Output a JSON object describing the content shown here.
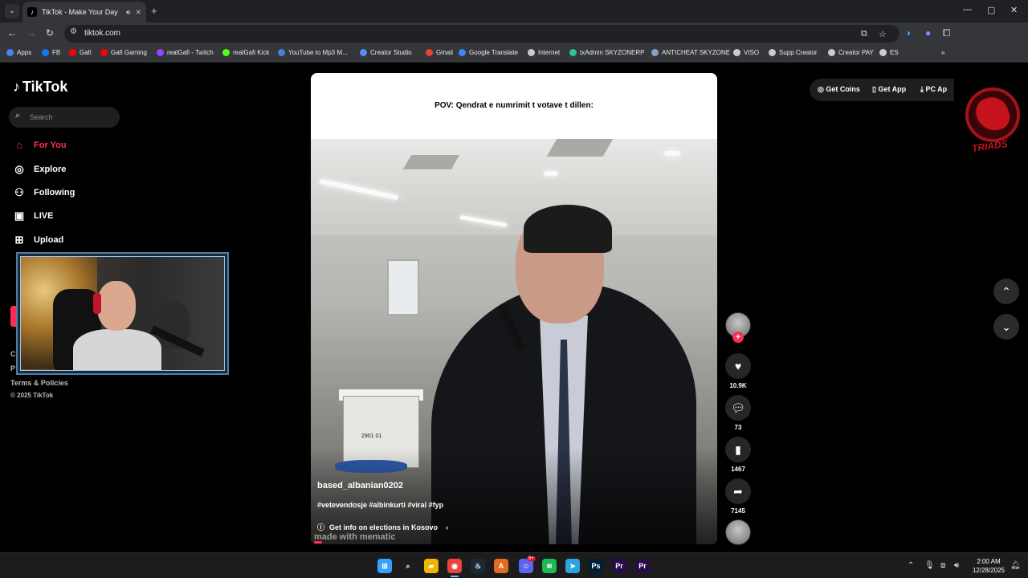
{
  "browser": {
    "tab": {
      "title": "TikTok - Make Your Day"
    },
    "new_tab": "+",
    "window_controls": {
      "minimize": "—",
      "maximize": "▢",
      "close": "✕"
    },
    "url": "tiktok.com",
    "bookmarks": [
      {
        "label": "Apps",
        "color": "#4285f4"
      },
      {
        "label": "FB",
        "color": "#1877f2"
      },
      {
        "label": "Gafi",
        "color": "#ff0000"
      },
      {
        "label": "Gafi Gaming",
        "color": "#ff0000"
      },
      {
        "label": "realGafi - Twitch",
        "color": "#9146ff"
      },
      {
        "label": "realGafi Kick",
        "color": "#53fc18"
      },
      {
        "label": "YouTube to Mp3 M...",
        "color": "#4a7fd8"
      },
      {
        "label": "Creator Studio",
        "color": "#5b8def"
      },
      {
        "label": "Gmail",
        "color": "#ea4335"
      },
      {
        "label": "Google Translate",
        "color": "#4285f4"
      },
      {
        "label": "Internet",
        "color": "#cccccc"
      },
      {
        "label": "txAdmin SKYZONERP",
        "color": "#27c59a"
      },
      {
        "label": "ANTICHEAT SKYZONE",
        "color": "#8aa0c8"
      },
      {
        "label": "VISO",
        "color": "#cccccc"
      },
      {
        "label": "Supp Creator",
        "color": "#cccccc"
      },
      {
        "label": "Creator PAY",
        "color": "#cccccc"
      },
      {
        "label": "ES",
        "color": "#cccccc"
      }
    ],
    "more_bookmarks": "»"
  },
  "tiktok": {
    "logo": "TikTok",
    "search_placeholder": "Search",
    "nav": [
      {
        "label": "For You",
        "icon": "home-icon"
      },
      {
        "label": "Explore",
        "icon": "compass-icon"
      },
      {
        "label": "Following",
        "icon": "people-icon"
      },
      {
        "label": "LIVE",
        "icon": "live-icon"
      },
      {
        "label": "Upload",
        "icon": "plus-square-icon"
      }
    ],
    "footer": {
      "peek_c": "C",
      "peek_p": "P",
      "terms": "Terms & Policies",
      "copyright": "© 2025 TikTok"
    },
    "top_actions": {
      "get_coins": "Get Coins",
      "get_app": "Get App",
      "pc_app": "PC Ap"
    },
    "video": {
      "overlay_text": "POV: Qendrat e numrimit t votave t dillen:",
      "author": "based_albanian0202",
      "hashtags": "#vetevendosje #albinkurti #viral #fyp",
      "info_link": "Get info on elections in Kosovo",
      "watermark": "made with mematic",
      "progress": 0.02,
      "box_label": "2901 01"
    },
    "actions": {
      "likes": "10.9K",
      "comments": "73",
      "saves": "1467",
      "shares": "7145"
    },
    "brand_text": "TRIADS"
  },
  "taskbar": {
    "apps": [
      {
        "name": "start",
        "glyph": "⊞",
        "color": "#3aa0ff"
      },
      {
        "name": "search",
        "glyph": "⌕",
        "color": "transparent"
      },
      {
        "name": "explorer",
        "glyph": "▰",
        "color": "#f2b400"
      },
      {
        "name": "chrome",
        "glyph": "◉",
        "color": "#e8453c"
      },
      {
        "name": "steam",
        "glyph": "♨",
        "color": "#1b2838"
      },
      {
        "name": "app-a",
        "glyph": "A",
        "color": "#e36b1e"
      },
      {
        "name": "discord",
        "glyph": "☺",
        "color": "#5865f2"
      },
      {
        "name": "spotify",
        "glyph": "≋",
        "color": "#1db954"
      },
      {
        "name": "telegram",
        "glyph": "➤",
        "color": "#2aa3df"
      },
      {
        "name": "photoshop",
        "glyph": "Ps",
        "color": "#001e36"
      },
      {
        "name": "premiere-1",
        "glyph": "Pr",
        "color": "#2a0b4a"
      },
      {
        "name": "premiere-2",
        "glyph": "Pr",
        "color": "#2a0b4a"
      }
    ],
    "discord_badge": "9+",
    "time": "2:00 AM",
    "date": "12/28/2025"
  }
}
